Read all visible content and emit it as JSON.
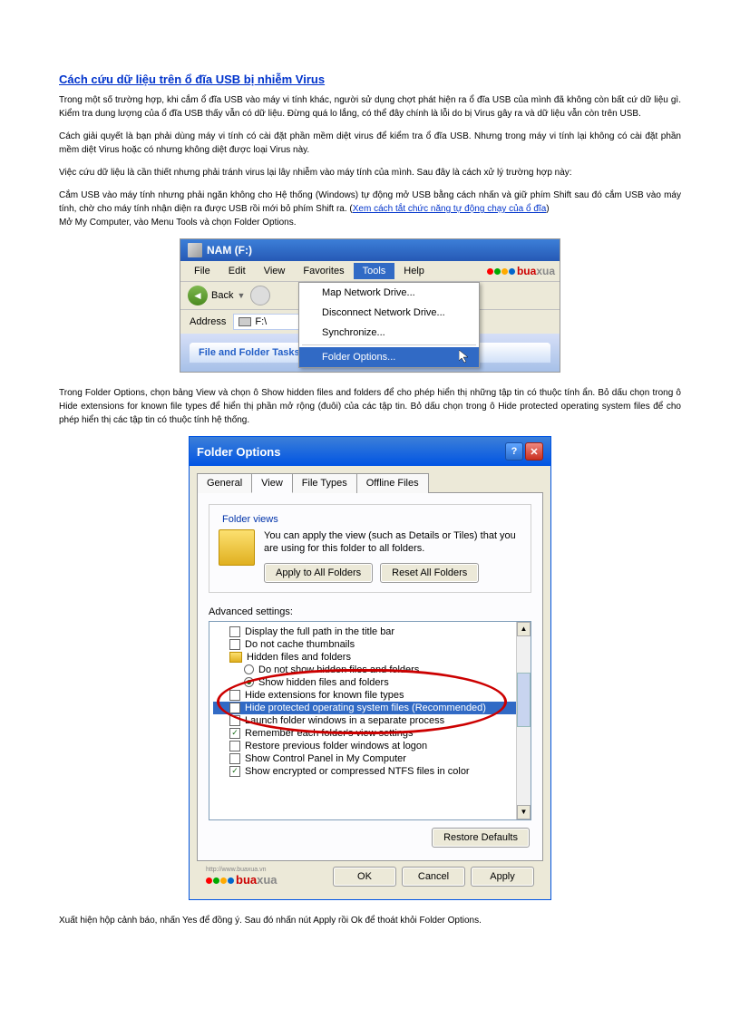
{
  "title": "Cách cứu dữ liệu trên ổ đĩa USB bị nhiễm Virus",
  "para1": "Trong một số trường hợp, khi cắm ổ đĩa USB vào máy vi tính khác, người sử dụng chợt phát hiện ra ổ đĩa USB của mình đã không còn bất cứ dữ liệu gì. Kiểm tra dung lượng của ổ đĩa USB thấy vẫn có dữ liệu. Đừng quá lo lắng, có thể đây chính là lỗi do bị Virus gây ra và dữ liệu vẫn còn trên USB.",
  "para2": "Cách giải quyết là bạn phải dùng máy vi tính có cài đặt phần mềm diệt virus để kiểm tra ổ đĩa USB. Nhưng trong máy vi tính lại không có cài đặt phần mềm diệt Virus hoặc có nhưng không diệt được loại Virus này.",
  "para3": "Việc cứu dữ liệu là cần thiết nhưng phải tránh virus lại lây nhiễm vào máy tính của mình. Sau đây là cách xử lý trường hợp này:",
  "para4a": "Cắm USB vào máy tính nhưng phải ngăn không cho Hệ thống (Windows) tự động mở USB bằng cách nhấn và giữ phím Shift sau đó cắm USB vào máy tính, chờ cho máy tính nhận diện ra được USB rồi mới bỏ phím Shift ra. (",
  "para4link": "Xem cách tắt chức năng tự động chạy của ổ đĩa",
  "para4b": ")",
  "para5": "Mở My Computer, vào Menu Tools và chọn Folder Options.",
  "explorer": {
    "title": "NAM (F:)",
    "menu": {
      "file": "File",
      "edit": "Edit",
      "view": "View",
      "favorites": "Favorites",
      "tools": "Tools",
      "help": "Help"
    },
    "back": "Back",
    "dropdown": {
      "map": "Map Network Drive...",
      "disconnect": "Disconnect Network Drive...",
      "sync": "Synchronize...",
      "folder_options": "Folder Options..."
    },
    "address_label": "Address",
    "address_value": "F:\\",
    "sidebar_title": "File and Folder Tasks"
  },
  "para6": "Trong Folder Options, chọn bảng View và chọn ô Show hidden files and folders để cho phép hiển thị những tập tin có thuộc tính ẩn. Bỏ dấu chọn trong ô Hide extensions for known file types để hiển thị phần mở rộng (đuôi) của các tập tin. Bỏ dấu chọn trong ô Hide protected operating system files để cho phép hiển thị các tập tin có thuộc tính hệ thống.",
  "fo": {
    "title": "Folder Options",
    "tabs": {
      "general": "General",
      "view": "View",
      "filetypes": "File Types",
      "offline": "Offline Files"
    },
    "folder_views_label": "Folder views",
    "folder_views_text": "You can apply the view (such as Details or Tiles) that you are using for this folder to all folders.",
    "apply_all": "Apply to All Folders",
    "reset_all": "Reset All Folders",
    "adv_label": "Advanced settings:",
    "items": {
      "display_fullpath": "Display the full path in the title bar",
      "no_cache": "Do not cache thumbnails",
      "hidden_folder": "Hidden files and folders",
      "do_not_show": "Do not show hidden files and folders",
      "show_hidden": "Show hidden files and folders",
      "hide_ext": "Hide extensions for known file types",
      "hide_protected": "Hide protected operating system files (Recommended)",
      "launch_sep": "Launch folder windows in a separate process",
      "remember": "Remember each folder's view settings",
      "restore_prev": "Restore previous folder windows at logon",
      "show_cp": "Show Control Panel in My Computer",
      "show_enc": "Show encrypted or compressed NTFS files in color"
    },
    "restore_defaults": "Restore Defaults",
    "ok": "OK",
    "cancel": "Cancel",
    "apply": "Apply"
  },
  "logo": {
    "red": "bua",
    "grey": "xua",
    "url": "http://www.buaxua.vn"
  },
  "para7": "Xuất hiện hộp cảnh báo, nhấn Yes để đồng ý. Sau đó nhấn nút Apply rồi Ok để thoát khỏi Folder Options."
}
